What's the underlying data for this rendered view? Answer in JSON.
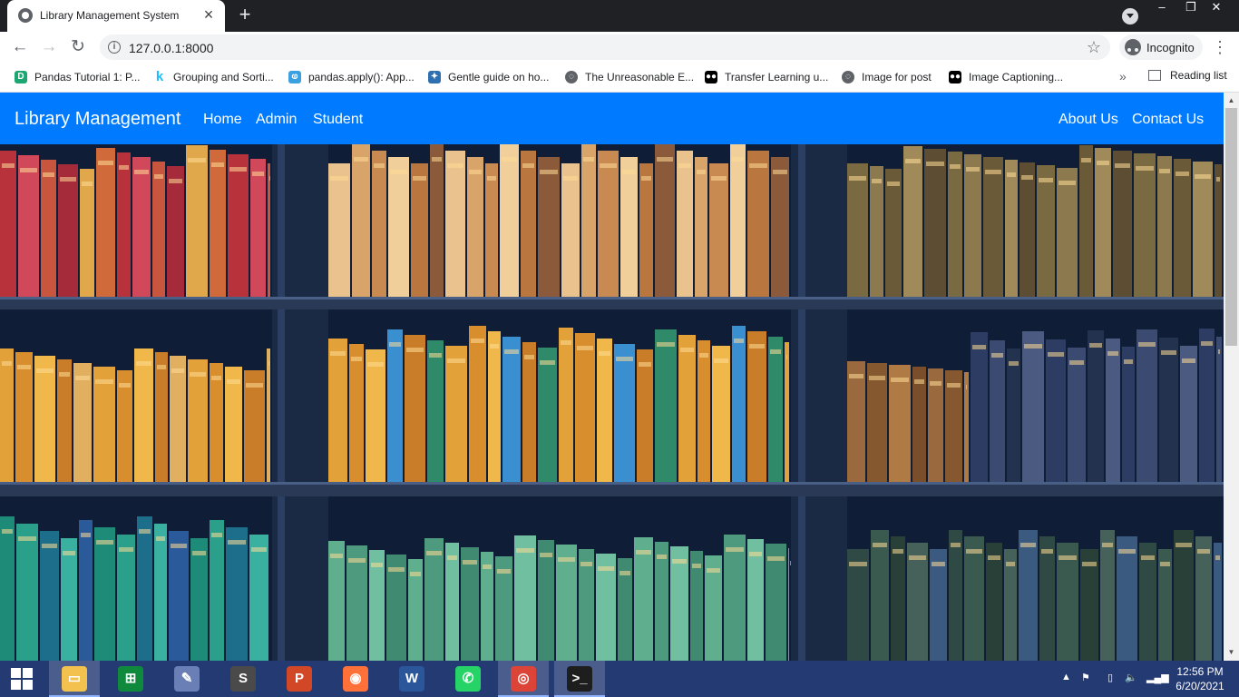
{
  "browser": {
    "tab_title": "Library Management System",
    "url": "127.0.0.1:8000",
    "incognito_label": "Incognito",
    "bookmarks": [
      {
        "label": "Pandas Tutorial 1: P...",
        "icon": "pandas-icon",
        "color": "#1ba672"
      },
      {
        "label": "Grouping and Sorti...",
        "icon": "kaggle-icon",
        "color": "#20beff"
      },
      {
        "label": "pandas.apply(): App...",
        "icon": "feather-icon",
        "color": "#3aa0e0"
      },
      {
        "label": "Gentle guide on ho...",
        "icon": "python-icon",
        "color": "#2d6fb0"
      },
      {
        "label": "The Unreasonable E...",
        "icon": "globe-icon",
        "color": "#5f6368"
      },
      {
        "label": "Transfer Learning u...",
        "icon": "medium-icon",
        "color": "#000000"
      },
      {
        "label": "Image for post",
        "icon": "globe-icon",
        "color": "#5f6368"
      },
      {
        "label": "Image Captioning...",
        "icon": "medium-icon",
        "color": "#000000"
      }
    ],
    "more_bookmarks": "»",
    "reading_list": "Reading list"
  },
  "site": {
    "brand": "Library Management",
    "nav_left": [
      "Home",
      "Admin",
      "Student"
    ],
    "nav_right": [
      "About Us",
      "Contact Us"
    ],
    "accent": "#007bff"
  },
  "taskbar": {
    "apps": [
      {
        "name": "file-explorer-icon",
        "glyph": "▭",
        "color": "#f2c14e"
      },
      {
        "name": "store-icon",
        "glyph": "⊞",
        "color": "#0f8a3c"
      },
      {
        "name": "codeblocks-icon",
        "glyph": "✎",
        "color": "#6a7fb5"
      },
      {
        "name": "sublime-text-icon",
        "glyph": "S",
        "color": "#4a4a4a"
      },
      {
        "name": "powerpoint-icon",
        "glyph": "P",
        "color": "#d24726"
      },
      {
        "name": "firefox-icon",
        "glyph": "◉",
        "color": "#ff7139"
      },
      {
        "name": "word-icon",
        "glyph": "W",
        "color": "#2b579a"
      },
      {
        "name": "whatsapp-icon",
        "glyph": "✆",
        "color": "#25d366"
      },
      {
        "name": "chrome-icon",
        "glyph": "◎",
        "color": "#db4437"
      },
      {
        "name": "terminal-icon",
        "glyph": ">_",
        "color": "#1e1e1e"
      }
    ],
    "time": "12:56 PM",
    "date": "6/20/2021"
  }
}
